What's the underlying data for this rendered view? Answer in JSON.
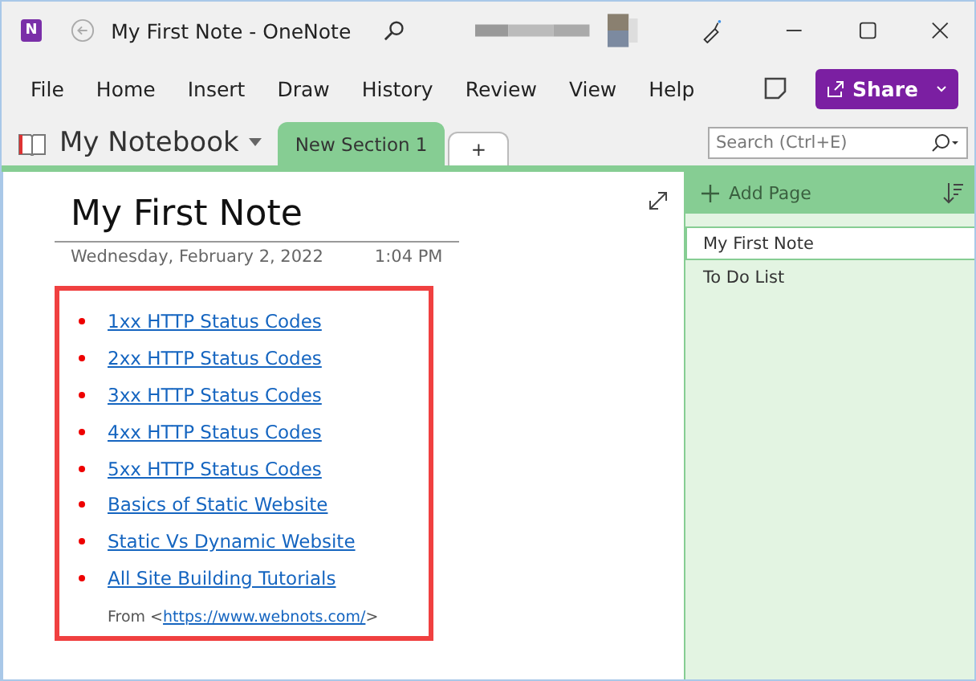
{
  "window": {
    "app_badge": "N",
    "title": "My First Note",
    "separator": "-",
    "app_name": "OneNote"
  },
  "menu": [
    {
      "label": "File"
    },
    {
      "label": "Home"
    },
    {
      "label": "Insert"
    },
    {
      "label": "Draw"
    },
    {
      "label": "History"
    },
    {
      "label": "Review"
    },
    {
      "label": "View"
    },
    {
      "label": "Help"
    }
  ],
  "share_button": {
    "label": "Share"
  },
  "notebook": {
    "name": "My Notebook"
  },
  "section_tabs": [
    {
      "label": "New Section 1",
      "selected": true
    },
    {
      "label": "+",
      "selected": false
    }
  ],
  "search": {
    "placeholder": "Search (Ctrl+E)"
  },
  "note": {
    "title": "My First Note",
    "date": "Wednesday, February 2, 2022",
    "time": "1:04 PM",
    "links": [
      "1xx HTTP Status Codes",
      "2xx HTTP Status Codes",
      "3xx HTTP Status Codes",
      "4xx HTTP Status Codes",
      "5xx HTTP Status Codes",
      "Basics of Static Website",
      "Static Vs Dynamic Website",
      "All Site Building Tutorials"
    ],
    "source_prefix": "From <",
    "source_url": "https://www.webnots.com/",
    "source_suffix": ">"
  },
  "pages_pane": {
    "add_label": "Add Page",
    "pages": [
      {
        "title": "My First Note",
        "selected": true
      },
      {
        "title": "To Do List",
        "selected": false
      }
    ]
  }
}
